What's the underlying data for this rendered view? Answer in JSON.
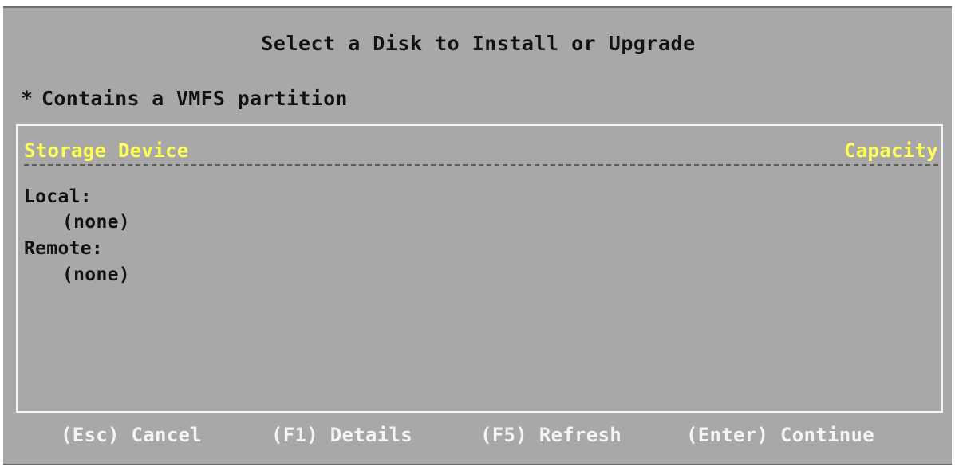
{
  "dialog": {
    "title": "Select a Disk to Install or Upgrade",
    "legend_marker": "*",
    "legend_text": "Contains a VMFS partition"
  },
  "table": {
    "columns": {
      "device": "Storage Device",
      "capacity": "Capacity"
    },
    "groups": [
      {
        "label": "Local:",
        "entries": [
          "(none)"
        ]
      },
      {
        "label": "Remote:",
        "entries": [
          "(none)"
        ]
      }
    ]
  },
  "footer": {
    "keys": [
      {
        "label": "(Esc) Cancel"
      },
      {
        "label": "(F1) Details"
      },
      {
        "label": "(F5) Refresh"
      },
      {
        "label": "(Enter) Continue"
      }
    ]
  },
  "colors": {
    "background": "#a8a8a8",
    "header_text": "#ffff5a",
    "footer_text": "#f4f4f4",
    "body_text": "#111111",
    "frame_border": "#f4f4f4"
  }
}
